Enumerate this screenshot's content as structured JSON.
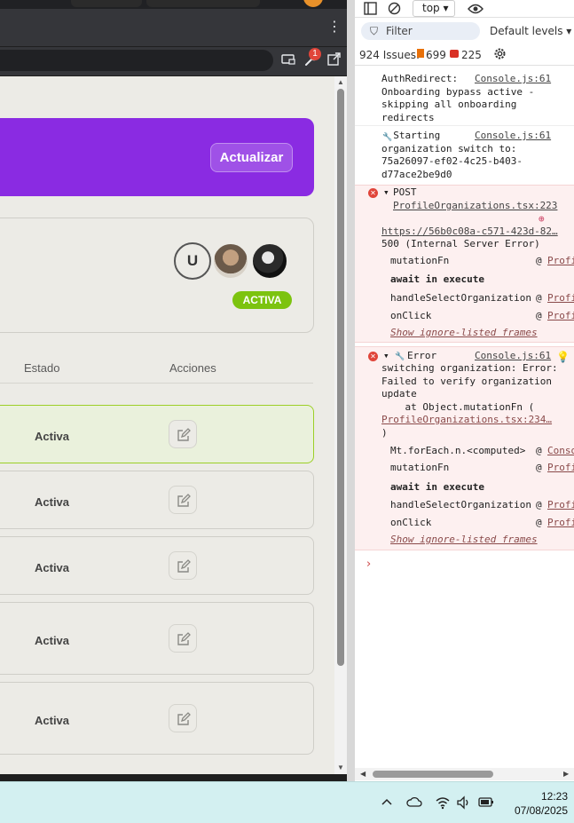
{
  "browser": {
    "menu_glyph": "⋮",
    "extension_badge": "1"
  },
  "page": {
    "update_button": "Actualizar",
    "avatar_initial": "U",
    "org_status": "ACTIVA",
    "columns": {
      "estado": "Estado",
      "acciones": "Acciones"
    },
    "rows": [
      {
        "status": "Activa",
        "selected": true
      },
      {
        "status": "Activa",
        "selected": false
      },
      {
        "status": "Activa",
        "selected": false
      },
      {
        "status": "Activa",
        "selected": false
      },
      {
        "status": "Activa",
        "selected": false
      }
    ]
  },
  "devtools": {
    "context": "top",
    "filter_placeholder": "Filter",
    "levels": "Default levels",
    "issues": {
      "total": "924 Issues:",
      "warnings": "699",
      "info": "225"
    },
    "messages": {
      "m1_text": "AuthRedirect:\nOnboarding bypass active -\nskipping all onboarding\nredirects",
      "m1_src": "Console.js:61",
      "m2_text": "  Starting\norganization switch to:\n75a26097-ef02-4c25-b403-\nd77ace2be9d0",
      "m2_src": "Console.js:61",
      "m3_method": "POST",
      "m3_src": "ProfileOrganizations.tsx:223",
      "m3_url": "https://56b0c08a-c571-423d-82…",
      "m3_status": "500 (Internal Server Error)",
      "m3_stack": [
        {
          "fn": "mutationFn",
          "at": "@",
          "link": "Profi",
          "bold": false
        },
        {
          "fn": "await in execute",
          "at": "",
          "link": "",
          "bold": true
        },
        {
          "fn": "handleSelectOrganization",
          "at": "@",
          "link": "Profi",
          "bold": false
        },
        {
          "fn": "onClick",
          "at": "@",
          "link": "Profi",
          "bold": false
        }
      ],
      "m3_ignore": "Show ignore-listed frames",
      "m4_label": "Error",
      "m4_src": "Console.js:61",
      "m4_text": "switching organization: Error:\nFailed to verify organization\nupdate\n    at Object.mutationFn (",
      "m4_link": "ProfileOrganizations.tsx:234…",
      "m4_close": ")",
      "m4_stack": [
        {
          "fn": "Mt.forEach.n.<computed>",
          "at": "@",
          "link": "Conso",
          "bold": false
        },
        {
          "fn": "mutationFn",
          "at": "@",
          "link": "Profi",
          "bold": false
        },
        {
          "fn": "await in execute",
          "at": "",
          "link": "",
          "bold": true
        },
        {
          "fn": "handleSelectOrganization",
          "at": "@",
          "link": "Profi",
          "bold": false
        },
        {
          "fn": "onClick",
          "at": "@",
          "link": "Profi",
          "bold": false
        }
      ],
      "m4_ignore": "Show ignore-listed frames"
    },
    "prompt": "›"
  },
  "taskbar": {
    "time": "12:23",
    "date": "07/08/2025"
  },
  "colors": {
    "banner": "#8a2be2",
    "active_pill": "#7cc30f",
    "selected_row_border": "#9ccf27",
    "error_bg": "#fdf0f0",
    "taskbar": "#d3f0f1"
  }
}
